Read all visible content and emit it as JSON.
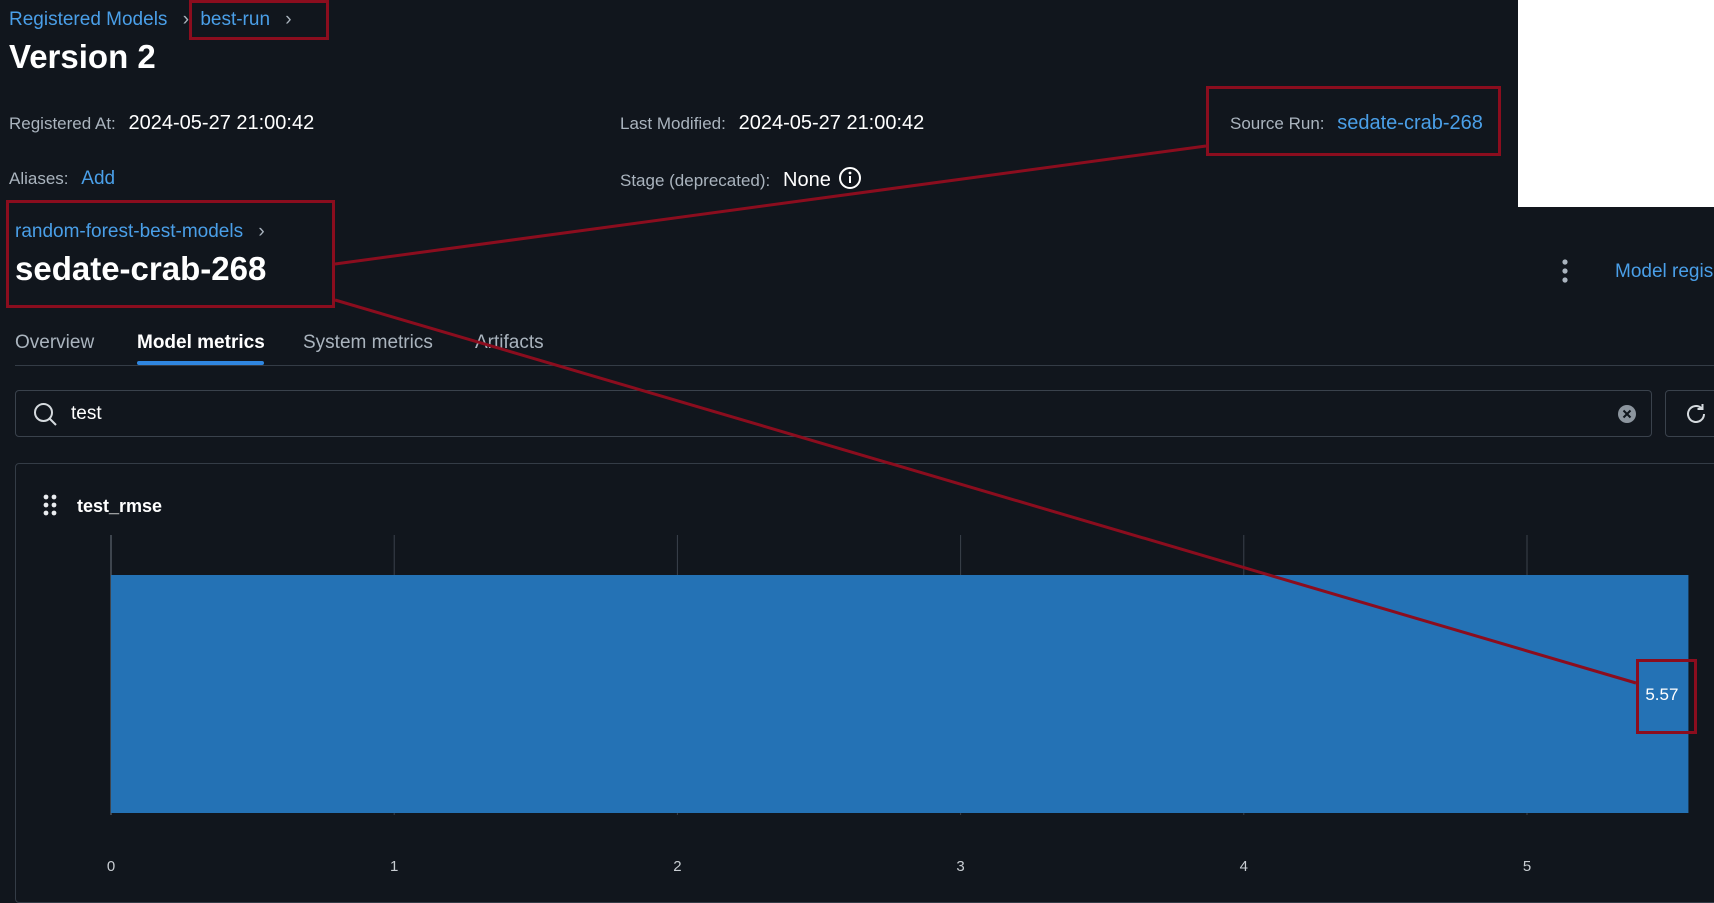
{
  "header": {
    "breadcrumb": {
      "root": "Registered Models",
      "model": "best-run"
    },
    "title": "Version 2",
    "registered_at": {
      "label": "Registered At:",
      "value": "2024-05-27 21:00:42"
    },
    "last_modified": {
      "label": "Last Modified:",
      "value": "2024-05-27 21:00:42"
    },
    "source_run": {
      "label": "Source Run:",
      "value": "sedate-crab-268"
    },
    "aliases": {
      "label": "Aliases:",
      "action": "Add"
    },
    "stage": {
      "label": "Stage (deprecated):",
      "value": "None"
    }
  },
  "run": {
    "breadcrumb": "random-forest-best-models",
    "title": "sedate-crab-268",
    "model_registry_link": "Model regis"
  },
  "tabs": [
    {
      "label": "Overview",
      "active": false
    },
    {
      "label": "Model metrics",
      "active": true
    },
    {
      "label": "System metrics",
      "active": false
    },
    {
      "label": "Artifacts",
      "active": false
    }
  ],
  "search": {
    "value": "test"
  },
  "metric_card": {
    "title": "test_rmse"
  },
  "chart_data": {
    "type": "bar",
    "orientation": "horizontal",
    "categories": [
      "sedate-crab-268"
    ],
    "values": [
      5.57
    ],
    "data_labels": [
      "5.57"
    ],
    "title": "test_rmse",
    "xticks": [
      0,
      1,
      2,
      3,
      4,
      5
    ],
    "xlim": [
      0,
      5.6
    ],
    "grid": true,
    "bar_color": "#2472b5"
  },
  "colors": {
    "background": "#11161d",
    "link": "#4a9fe8",
    "highlight_box": "#8b0d1e",
    "tab_underline": "#2f86e0"
  }
}
